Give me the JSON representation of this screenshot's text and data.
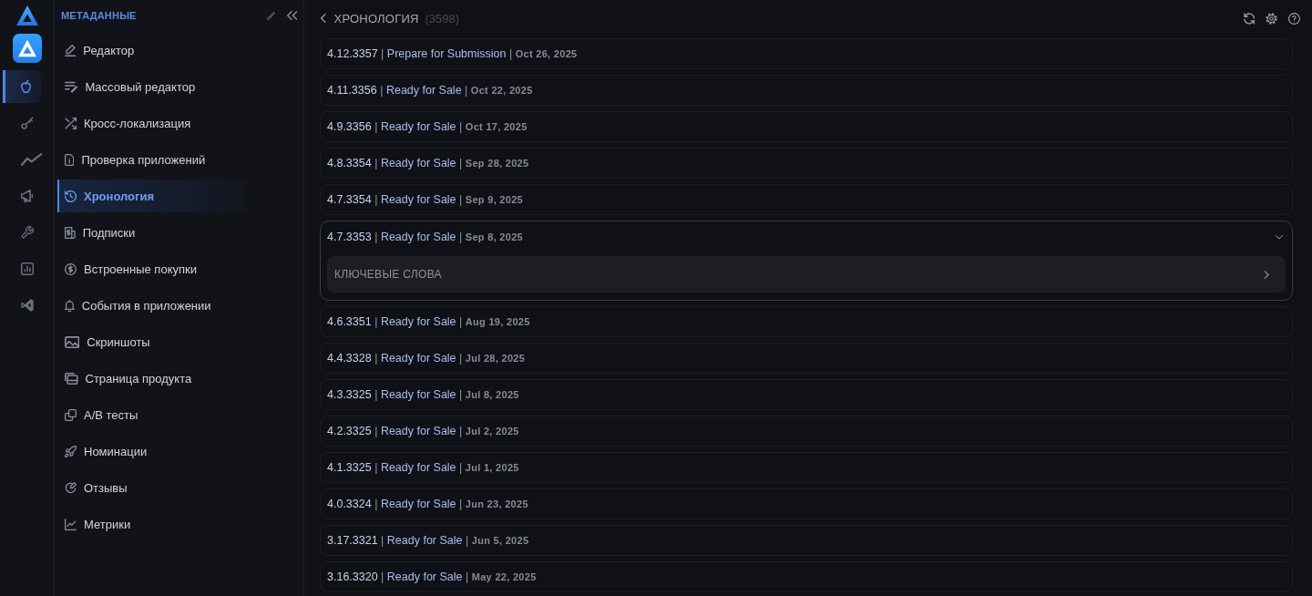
{
  "rail": {
    "items": [
      {
        "selected": true
      },
      {
        "selected": false
      },
      {
        "selected": false
      },
      {
        "selected": false
      },
      {
        "selected": false
      },
      {
        "selected": false
      },
      {
        "selected": false
      }
    ]
  },
  "sidebar": {
    "title": "МЕТАДАННЫЕ",
    "items": [
      {
        "label": "Редактор",
        "selected": false
      },
      {
        "label": "Массовый редактор",
        "selected": false
      },
      {
        "label": "Кросс-локализация",
        "selected": false
      },
      {
        "label": "Проверка приложений",
        "selected": false
      },
      {
        "label": "Хронология",
        "selected": true
      },
      {
        "label": "Подписки",
        "selected": false
      },
      {
        "label": "Встроенные покупки",
        "selected": false
      },
      {
        "label": "События в приложении",
        "selected": false
      },
      {
        "label": "Скриншоты",
        "selected": false
      },
      {
        "label": "Страница продукта",
        "selected": false
      },
      {
        "label": "A/B тесты",
        "selected": false
      },
      {
        "label": "Номинации",
        "selected": false
      },
      {
        "label": "Отзывы",
        "selected": false
      },
      {
        "label": "Метрики",
        "selected": false
      }
    ]
  },
  "timeline": {
    "title": "ХРОНОЛОГИЯ",
    "count": "(3598)",
    "versions": [
      {
        "version": "4.12.3357",
        "separator_1": "|",
        "status": "Prepare for Submission",
        "separator_2": "|",
        "date": "Oct 26, 2025",
        "expanded": false
      },
      {
        "version": "4.11.3356",
        "separator_1": "|",
        "status": "Ready for Sale",
        "separator_2": "|",
        "date": "Oct 22, 2025",
        "expanded": false
      },
      {
        "version": "4.9.3356",
        "separator_1": "|",
        "status": "Ready for Sale",
        "separator_2": "|",
        "date": "Oct 17, 2025",
        "expanded": false
      },
      {
        "version": "4.8.3354",
        "separator_1": "|",
        "status": "Ready for Sale",
        "separator_2": "|",
        "date": "Sep 28, 2025",
        "expanded": false
      },
      {
        "version": "4.7.3354",
        "separator_1": "|",
        "status": "Ready for Sale",
        "separator_2": "|",
        "date": "Sep 9, 2025",
        "expanded": false
      },
      {
        "version": "4.7.3353",
        "separator_1": "|",
        "status": "Ready for Sale",
        "separator_2": "|",
        "date": "Sep 8, 2025",
        "expanded": true,
        "sections": [
          {
            "label": "КЛЮЧЕВЫЕ СЛОВА"
          }
        ]
      },
      {
        "version": "4.6.3351",
        "separator_1": "|",
        "status": "Ready for Sale",
        "separator_2": "|",
        "date": "Aug 19, 2025",
        "expanded": false
      },
      {
        "version": "4.4.3328",
        "separator_1": "|",
        "status": "Ready for Sale",
        "separator_2": "|",
        "date": "Jul 28, 2025",
        "expanded": false
      },
      {
        "version": "4.3.3325",
        "separator_1": "|",
        "status": "Ready for Sale",
        "separator_2": "|",
        "date": "Jul 8, 2025",
        "expanded": false
      },
      {
        "version": "4.2.3325",
        "separator_1": "|",
        "status": "Ready for Sale",
        "separator_2": "|",
        "date": "Jul 2, 2025",
        "expanded": false
      },
      {
        "version": "4.1.3325",
        "separator_1": "|",
        "status": "Ready for Sale",
        "separator_2": "|",
        "date": "Jul 1, 2025",
        "expanded": false
      },
      {
        "version": "4.0.3324",
        "separator_1": "|",
        "status": "Ready for Sale",
        "separator_2": "|",
        "date": "Jun 23, 2025",
        "expanded": false
      },
      {
        "version": "3.17.3321",
        "separator_1": "|",
        "status": "Ready for Sale",
        "separator_2": "|",
        "date": "Jun 5, 2025",
        "expanded": false
      },
      {
        "version": "3.16.3320",
        "separator_1": "|",
        "status": "Ready for Sale",
        "separator_2": "|",
        "date": "May 22, 2025",
        "expanded": false
      }
    ]
  }
}
